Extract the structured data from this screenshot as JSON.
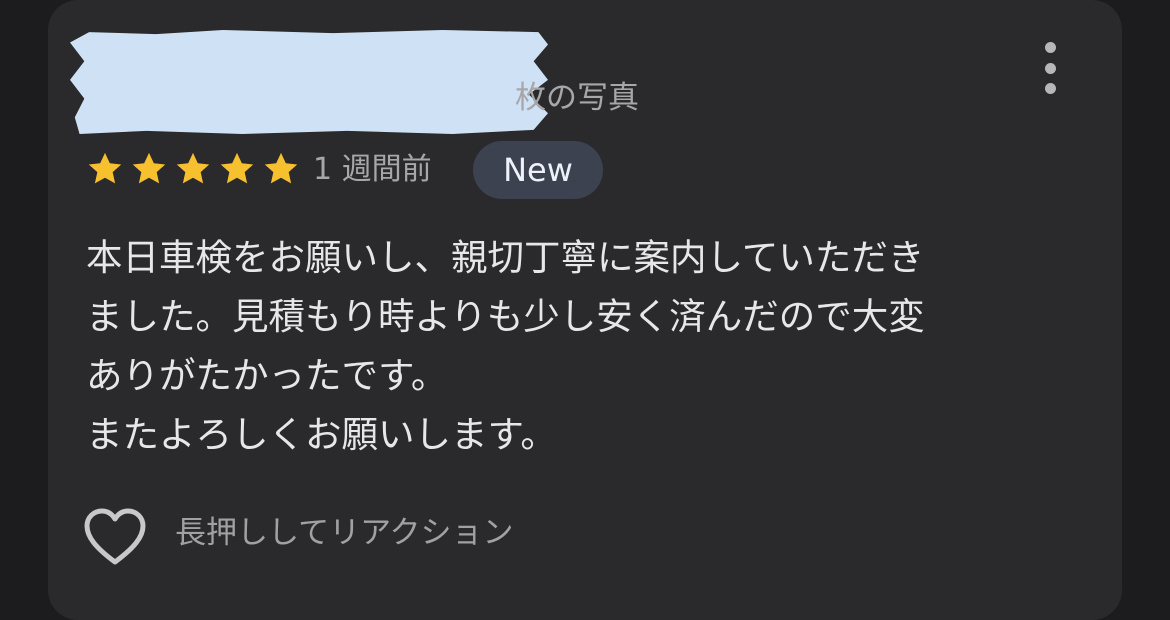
{
  "review": {
    "reviewer_photos_suffix": "枚の写真",
    "rating": 5,
    "time_ago": "1 週間前",
    "badge": "New",
    "text_lines": [
      "本日車検をお願いし、親切丁寧に案内していただき",
      "ました。見積もり時よりも少し安く済んだので大変",
      "ありがたかったです。",
      "またよろしくお願いします。"
    ],
    "reaction_hint": "長押ししてリアクション"
  },
  "icons": {
    "more": "more-vert-icon",
    "star": "star-icon",
    "heart": "heart-outline-icon"
  },
  "colors": {
    "card_background": "#2a2a2c",
    "star": "#f6c02e",
    "badge_background": "#3c4250",
    "redaction": "#cfe2f5"
  }
}
